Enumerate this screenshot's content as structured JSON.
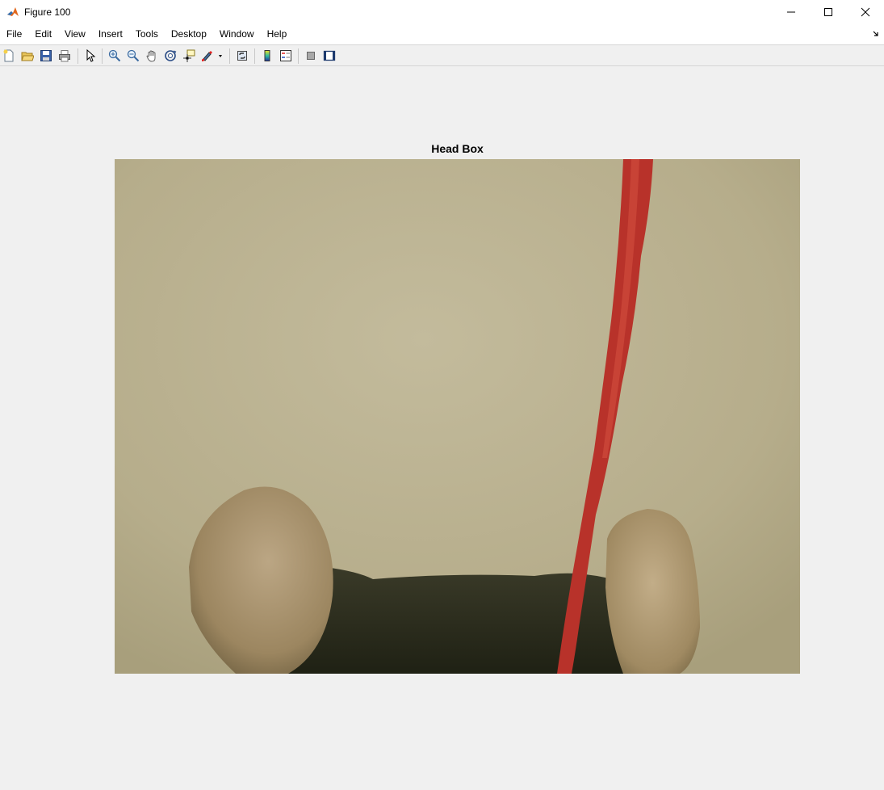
{
  "window": {
    "title": "Figure 100"
  },
  "menu": {
    "items": [
      "File",
      "Edit",
      "View",
      "Insert",
      "Tools",
      "Desktop",
      "Window",
      "Help"
    ]
  },
  "toolbar": {
    "buttons": [
      {
        "name": "new-figure-icon"
      },
      {
        "name": "open-file-icon"
      },
      {
        "name": "save-icon"
      },
      {
        "name": "print-icon"
      },
      {
        "name": "edit-plot-pointer-icon"
      },
      {
        "name": "zoom-in-icon"
      },
      {
        "name": "zoom-out-icon"
      },
      {
        "name": "pan-hand-icon"
      },
      {
        "name": "rotate-3d-icon"
      },
      {
        "name": "data-cursor-icon"
      },
      {
        "name": "brush-icon"
      },
      {
        "name": "link-plot-icon"
      },
      {
        "name": "insert-colorbar-icon"
      },
      {
        "name": "insert-legend-icon"
      },
      {
        "name": "hide-plot-tools-icon"
      },
      {
        "name": "show-plot-tools-icon"
      }
    ]
  },
  "axes": {
    "title": "Head Box"
  },
  "colors": {
    "background": "#f0f0f0",
    "wall": "#b9b08f",
    "cable": "#b8322a",
    "fur": "#2a2a1c",
    "ear": "#a08c64"
  }
}
